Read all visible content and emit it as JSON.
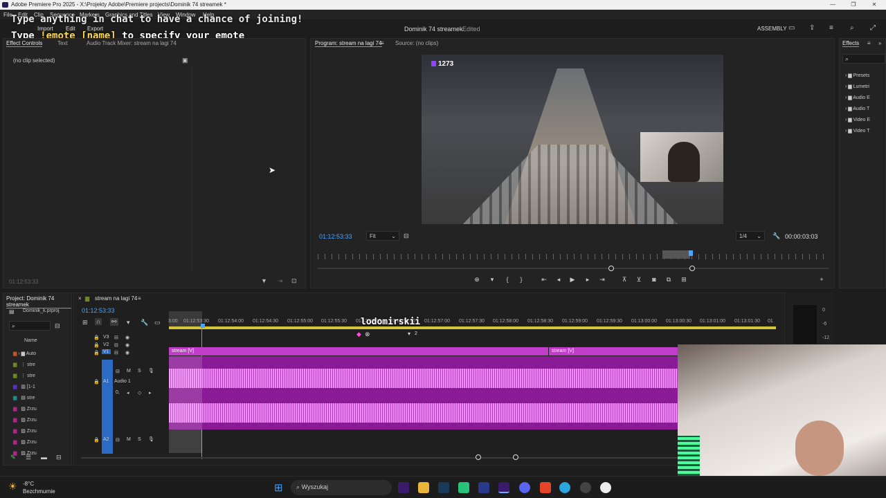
{
  "window": {
    "title": "Adobe Premiere Pro 2025 - X:\\Projekty Adobe\\Premiere projects\\Dominik 74 streamek *"
  },
  "menu": {
    "items": [
      "File",
      "Edit",
      "Clip",
      "Sequence",
      "Markers",
      "Graphics and Titles",
      "View",
      "Window",
      "Help"
    ]
  },
  "header": {
    "project_title": "Dominik 74 streamek",
    "status": "Edited",
    "workspace": "ASSEMBLY",
    "tabs": [
      "Import",
      "Edit",
      "Export"
    ]
  },
  "overlay": {
    "line1": "Type anything in chat to have a chance of joining!",
    "line2_pre": "Type ",
    "line2_cmd": "!emote [name]",
    "line2_post": " to specify your emote"
  },
  "effect_controls": {
    "tabs": [
      "Effect Controls",
      "Text",
      "Audio Track Mixer: stream na lagi 74"
    ],
    "empty_text": "(no clip selected)",
    "timecode": "01:12:53:33"
  },
  "program": {
    "tabs": [
      "Program: stream na lagi 74",
      "Source: (no clips)"
    ],
    "timecode": "01:12:53:33",
    "fit": "Fit",
    "resolution": "1/4",
    "duration": "00:00:03:03",
    "viewer_count": "1273"
  },
  "effects": {
    "title": "Effects",
    "items": [
      "Presets",
      "Lumetri",
      "Audio E",
      "Audio T",
      "Video E",
      "Video T"
    ]
  },
  "project": {
    "title": "Project: Dominik 74 streamek",
    "file": "Dominik_k.prproj",
    "name_header": "Name",
    "items": [
      "Auto",
      "stre",
      "stre",
      "[1-1",
      "stre",
      "Zrzu",
      "Zrzu",
      "Zrzu",
      "Zrzu",
      "Zrzu"
    ]
  },
  "timeline": {
    "tab": "stream na lagi 74",
    "timecode": "01:12:53:33",
    "ruler": [
      "3:00",
      "01:12:53:30",
      "01:12:54:00",
      "01:12:54:30",
      "01:12:55:00",
      "01:12:55:30",
      "01:12:56:00",
      "01:12:56:30",
      "01:12:57:00",
      "01:12:57:30",
      "01:12:58:00",
      "01:12:58:30",
      "01:12:59:00",
      "01:12:59:30",
      "01:13:00:00",
      "01:13:00:30",
      "01:13:01:00",
      "01:13:01:30",
      "01"
    ],
    "tracks": [
      "V3",
      "V2",
      "V1",
      "A1",
      "A2"
    ],
    "audio_name": "Audio 1",
    "clip1": "stream [V]",
    "clip2": "stream [V]",
    "chat_name": "lodomirskii",
    "meter_ticks": [
      "0",
      "-6",
      "-12"
    ],
    "marker2": "2",
    "level": "0,"
  },
  "taskbar": {
    "weather_temp": "-8°C",
    "weather_desc": "Bezchmurnie",
    "search_placeholder": "Wyszukaj"
  }
}
